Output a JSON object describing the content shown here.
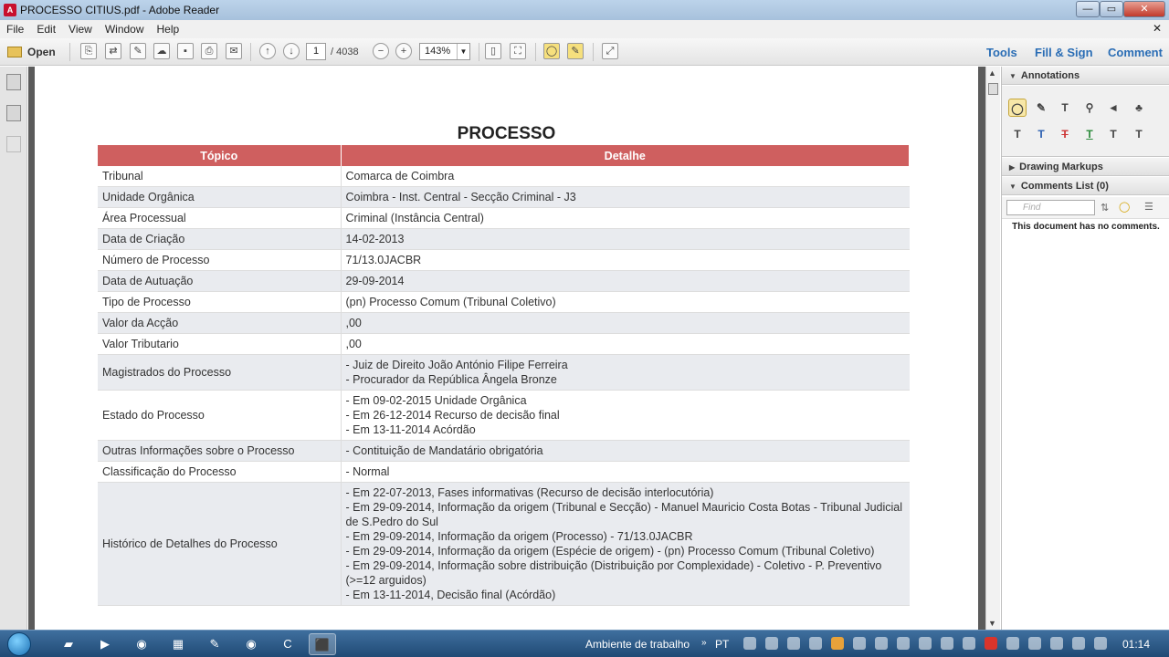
{
  "window": {
    "title": "PROCESSO CITIUS.pdf - Adobe Reader",
    "app_icon": "adobe-reader-icon",
    "min_label": "—",
    "max_label": "▭",
    "close_label": "✕"
  },
  "menu": {
    "items": [
      "File",
      "Edit",
      "View",
      "Window",
      "Help"
    ],
    "close_glyph": "✕"
  },
  "toolbar": {
    "open_label": "Open",
    "page_current": "1",
    "page_total": "/ 4038",
    "zoom": "143%",
    "tools_label": "Tools",
    "fill_sign_label": "Fill & Sign",
    "comment_label": "Comment"
  },
  "document": {
    "title": "PROCESSO",
    "headers": [
      "Tópico",
      "Detalhe"
    ],
    "rows": [
      {
        "topic": "Tribunal",
        "detail": [
          "Comarca de Coimbra"
        ]
      },
      {
        "topic": "Unidade Orgânica",
        "detail": [
          "Coimbra - Inst. Central - Secção Criminal - J3"
        ]
      },
      {
        "topic": "Área Processual",
        "detail": [
          "Criminal (Instância Central)"
        ]
      },
      {
        "topic": "Data de Criação",
        "detail": [
          "14-02-2013"
        ]
      },
      {
        "topic": "Número de Processo",
        "detail": [
          "71/13.0JACBR"
        ]
      },
      {
        "topic": "Data de Autuação",
        "detail": [
          "29-09-2014"
        ]
      },
      {
        "topic": "Tipo de Processo",
        "detail": [
          "(pn) Processo Comum (Tribunal Coletivo)"
        ]
      },
      {
        "topic": "Valor da Acção",
        "detail": [
          ",00"
        ]
      },
      {
        "topic": "Valor Tributario",
        "detail": [
          ",00"
        ]
      },
      {
        "topic": "Magistrados do Processo",
        "detail": [
          "- Juiz de Direito João António Filipe Ferreira",
          "- Procurador da República Ângela Bronze"
        ]
      },
      {
        "topic": "Estado do Processo",
        "detail": [
          "- Em 09-02-2015 Unidade Orgânica",
          "- Em 26-12-2014 Recurso de decisão final",
          "- Em 13-11-2014 Acórdão"
        ]
      },
      {
        "topic": "Outras Informações sobre o Processo",
        "detail": [
          "- Contituição de Mandatário obrigatória"
        ]
      },
      {
        "topic": "Classificação do Processo",
        "detail": [
          "- Normal"
        ]
      },
      {
        "topic": "Histórico de Detalhes do Processo",
        "detail": [
          "- Em 22-07-2013, Fases informativas (Recurso de decisão interlocutória)",
          "- Em 29-09-2014, Informação da origem (Tribunal e Secção) - Manuel Mauricio Costa Botas - Tribunal Judicial de S.Pedro do Sul",
          "- Em 29-09-2014, Informação da origem (Processo) - 71/13.0JACBR",
          "- Em 29-09-2014, Informação da origem (Espécie de origem) - (pn) Processo Comum (Tribunal Coletivo)",
          "- Em 29-09-2014, Informação sobre distribuição (Distribuição por Complexidade) - Coletivo - P. Preventivo (>=12 arguidos)",
          "- Em 13-11-2014, Decisão final (Acórdão)"
        ]
      }
    ]
  },
  "panel": {
    "annotations_label": "Annotations",
    "drawing_label": "Drawing Markups",
    "comments_list_label": "Comments List (0)",
    "filter_placeholder": "Find",
    "no_comments": "This document has no comments."
  },
  "taskbar": {
    "desktop_label": "Ambiente de trabalho",
    "lang": "PT",
    "clock": "01:14"
  }
}
